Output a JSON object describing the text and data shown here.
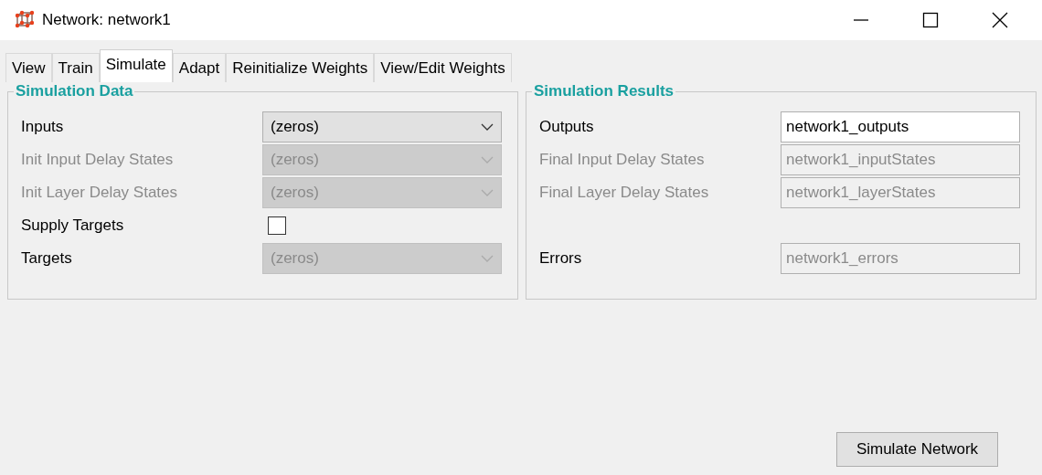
{
  "window": {
    "title": "Network: network1"
  },
  "tabs": [
    {
      "label": "View",
      "selected": false
    },
    {
      "label": "Train",
      "selected": false
    },
    {
      "label": "Simulate",
      "selected": true
    },
    {
      "label": "Adapt",
      "selected": false
    },
    {
      "label": "Reinitialize Weights",
      "selected": false
    },
    {
      "label": "View/Edit Weights",
      "selected": false
    }
  ],
  "groups": [
    {
      "title": "Simulation Data",
      "rows": [
        {
          "kind": "select",
          "label": "Inputs",
          "value": "(zeros)",
          "disabled": false,
          "label_dimmed": false
        },
        {
          "kind": "select",
          "label": "Init Input Delay States",
          "value": "(zeros)",
          "disabled": true,
          "label_dimmed": true
        },
        {
          "kind": "select",
          "label": "Init Layer Delay States",
          "value": "(zeros)",
          "disabled": true,
          "label_dimmed": true
        },
        {
          "kind": "checkbox",
          "label": "Supply Targets",
          "checked": false
        },
        {
          "kind": "select",
          "label": "Targets",
          "value": "(zeros)",
          "disabled": true,
          "label_dimmed": false
        }
      ]
    },
    {
      "title": "Simulation Results",
      "rows": [
        {
          "kind": "text",
          "label": "Outputs",
          "value": "network1_outputs",
          "disabled": false,
          "label_dimmed": false
        },
        {
          "kind": "text",
          "label": "Final Input Delay States",
          "value": "network1_inputStates",
          "disabled": true,
          "label_dimmed": true
        },
        {
          "kind": "text",
          "label": "Final Layer Delay States",
          "value": "network1_layerStates",
          "disabled": true,
          "label_dimmed": true
        },
        {
          "kind": "spacer"
        },
        {
          "kind": "text",
          "label": "Errors",
          "value": "network1_errors",
          "disabled": true,
          "label_dimmed": false
        }
      ]
    }
  ],
  "button": "Simulate Network"
}
